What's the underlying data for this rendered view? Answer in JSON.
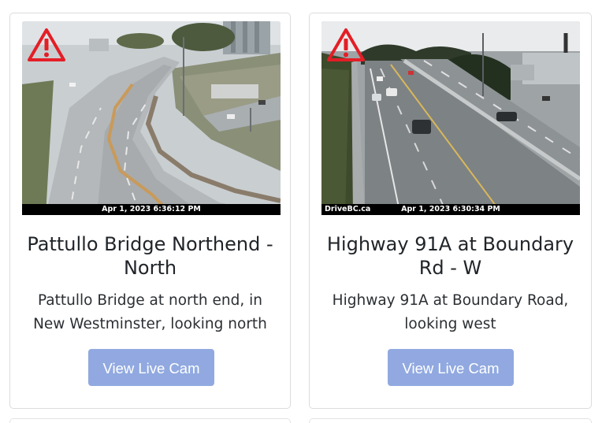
{
  "cards": [
    {
      "title": "Pattullo Bridge Northend - North",
      "description": "Pattullo Bridge at north end, in New Westminster, looking north",
      "timestamp": "Apr 1, 2023 6:36:12 PM",
      "brand": "",
      "button_label": "View Live Cam",
      "warning_icon": "warning-triangle-icon"
    },
    {
      "title": "Highway 91A at Boundary Rd - W",
      "description": "Highway 91A at Boundary Road, looking west",
      "timestamp": "Apr 1, 2023 6:30:34 PM",
      "brand": "DriveBC.ca",
      "button_label": "View Live Cam",
      "warning_icon": "warning-triangle-icon"
    }
  ],
  "colors": {
    "button_bg": "#91a9e0",
    "warning": "#e41e26",
    "card_border": "#dcdcdc"
  }
}
